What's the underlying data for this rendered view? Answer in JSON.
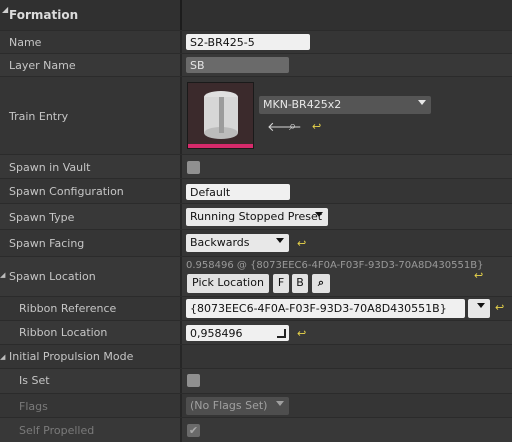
{
  "header": {
    "title": "Formation"
  },
  "rows": {
    "name": {
      "label": "Name",
      "value": "S2-BR425-5"
    },
    "layer_name": {
      "label": "Layer Name",
      "value": "SB"
    },
    "train_entry": {
      "label": "Train Entry",
      "asset": "MKN-BR425x2"
    },
    "spawn_in_vault": {
      "label": "Spawn in Vault",
      "checked": false
    },
    "spawn_configuration": {
      "label": "Spawn Configuration",
      "value": "Default"
    },
    "spawn_type": {
      "label": "Spawn Type",
      "value": "Running Stopped Preset"
    },
    "spawn_facing": {
      "label": "Spawn Facing",
      "value": "Backwards"
    },
    "spawn_location": {
      "label": "Spawn Location",
      "summary": "0.958496 @ {8073EEC6-4F0A-F03F-93D3-70A8D430551B}",
      "pick_label": "Pick Location",
      "f_label": "F",
      "b_label": "B"
    },
    "ribbon_reference": {
      "label": "Ribbon Reference",
      "value": "{8073EEC6-4F0A-F03F-93D3-70A8D430551B}"
    },
    "ribbon_location": {
      "label": "Ribbon Location",
      "value": "0,958496"
    },
    "initial_propulsion_mode": {
      "label": "Initial Propulsion Mode"
    },
    "is_set": {
      "label": "Is Set",
      "checked": false
    },
    "flags": {
      "label": "Flags",
      "value": "(No Flags Set)"
    },
    "self_propelled": {
      "label": "Self Propelled",
      "checked": true
    }
  },
  "icons": {
    "reset": "reset-arrow-icon",
    "search": "magnifier-icon",
    "back": "arrow-left-icon"
  },
  "colors": {
    "accent": "#d62a6b",
    "reset": "#e6d24a"
  }
}
